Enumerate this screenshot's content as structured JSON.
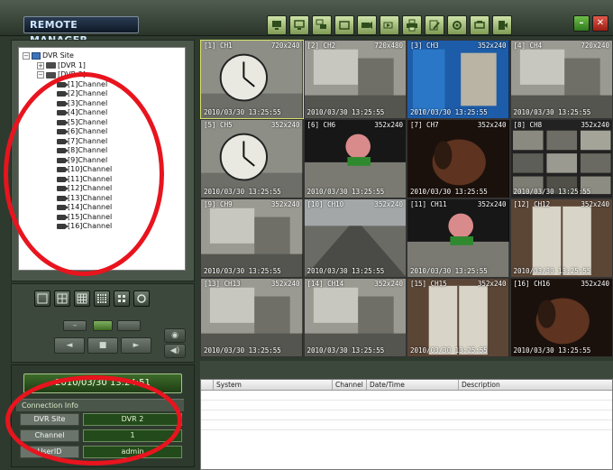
{
  "app": {
    "title": "REMOTE MANAGER"
  },
  "toolbar": {
    "buttons": [
      "monitor-icon",
      "monitor-icon",
      "multi-monitor-icon",
      "screen-icon",
      "record-icon",
      "playback-icon",
      "printer-icon",
      "edit-icon",
      "settings-icon",
      "print-icon",
      "exit-icon"
    ],
    "minimize": "–",
    "close": "✕"
  },
  "tree": {
    "root": "DVR Site",
    "dvrs": [
      "[DVR 1]",
      "[DVR 2]"
    ],
    "channels": [
      "[1]Channel",
      "[2]Channel",
      "[3]Channel",
      "[4]Channel",
      "[5]Channel",
      "[6]Channel",
      "[7]Channel",
      "[8]Channel",
      "[9]Channel",
      "[10]Channel",
      "[11]Channel",
      "[12]Channel",
      "[13]Channel",
      "[14]Channel",
      "[15]Channel",
      "[16]Channel"
    ]
  },
  "controls": {
    "layouts": [
      "1-split-icon",
      "4-split-icon",
      "9-split-icon",
      "16-split-icon",
      "sequence-icon",
      "refresh-icon"
    ],
    "ptz": {
      "up": "–",
      "stop": "■",
      "left": "◄",
      "right": "►",
      "audio": "◀)"
    }
  },
  "clock": {
    "text": "2010/03/30 13:24:51"
  },
  "connection": {
    "title": "Connection Info",
    "rows": [
      {
        "label": "DVR Site",
        "value": "DVR 2"
      },
      {
        "label": "Channel",
        "value": "1"
      },
      {
        "label": "UserID",
        "value": "admin"
      }
    ]
  },
  "channels": [
    {
      "name": "[1] CH1",
      "res": "720x240",
      "time": "2010/03/30 13:25:55",
      "scene": "clock"
    },
    {
      "name": "[2] CH2",
      "res": "720x480",
      "time": "2010/03/30 13:25:55",
      "scene": "room"
    },
    {
      "name": "[3] CH3",
      "res": "352x240",
      "time": "2010/03/30 13:25:55",
      "scene": "blue"
    },
    {
      "name": "[4] CH4",
      "res": "720x240",
      "time": "2010/03/30 13:25:55",
      "scene": "room"
    },
    {
      "name": "[5] CH5",
      "res": "352x240",
      "time": "2010/03/30 13:25:55",
      "scene": "clock"
    },
    {
      "name": "[6] CH6",
      "res": "352x240",
      "time": "2010/03/30 13:25:55",
      "scene": "doll"
    },
    {
      "name": "[7] CH7",
      "res": "352x240",
      "time": "2010/03/30 13:25:55",
      "scene": "dark"
    },
    {
      "name": "[8] CH8",
      "res": "352x240",
      "time": "2010/03/30 13:25:55",
      "scene": "mosaic"
    },
    {
      "name": "[9] CH9",
      "res": "352x240",
      "time": "2010/03/30 13:25:55",
      "scene": "room"
    },
    {
      "name": "[10] CH10",
      "res": "352x240",
      "time": "2010/03/30 13:25:55",
      "scene": "street"
    },
    {
      "name": "[11] CH11",
      "res": "352x240",
      "time": "2010/03/30 13:25:55",
      "scene": "doll"
    },
    {
      "name": "[12] CH12",
      "res": "352x240",
      "time": "2010/03/30 13:25:55",
      "scene": "door"
    },
    {
      "name": "[13] CH13",
      "res": "352x240",
      "time": "2010/03/30 13:25:55",
      "scene": "room"
    },
    {
      "name": "[14] CH14",
      "res": "352x240",
      "time": "2010/03/30 13:25:55",
      "scene": "room"
    },
    {
      "name": "[15] CH15",
      "res": "352x240",
      "time": "2010/03/30 13:25:55",
      "scene": "door"
    },
    {
      "name": "[16] CH16",
      "res": "352x240",
      "time": "2010/03/30 13:25:55",
      "scene": "dark"
    }
  ],
  "log": {
    "columns": [
      "System",
      "Channel",
      "Date/Time",
      "Description"
    ]
  }
}
